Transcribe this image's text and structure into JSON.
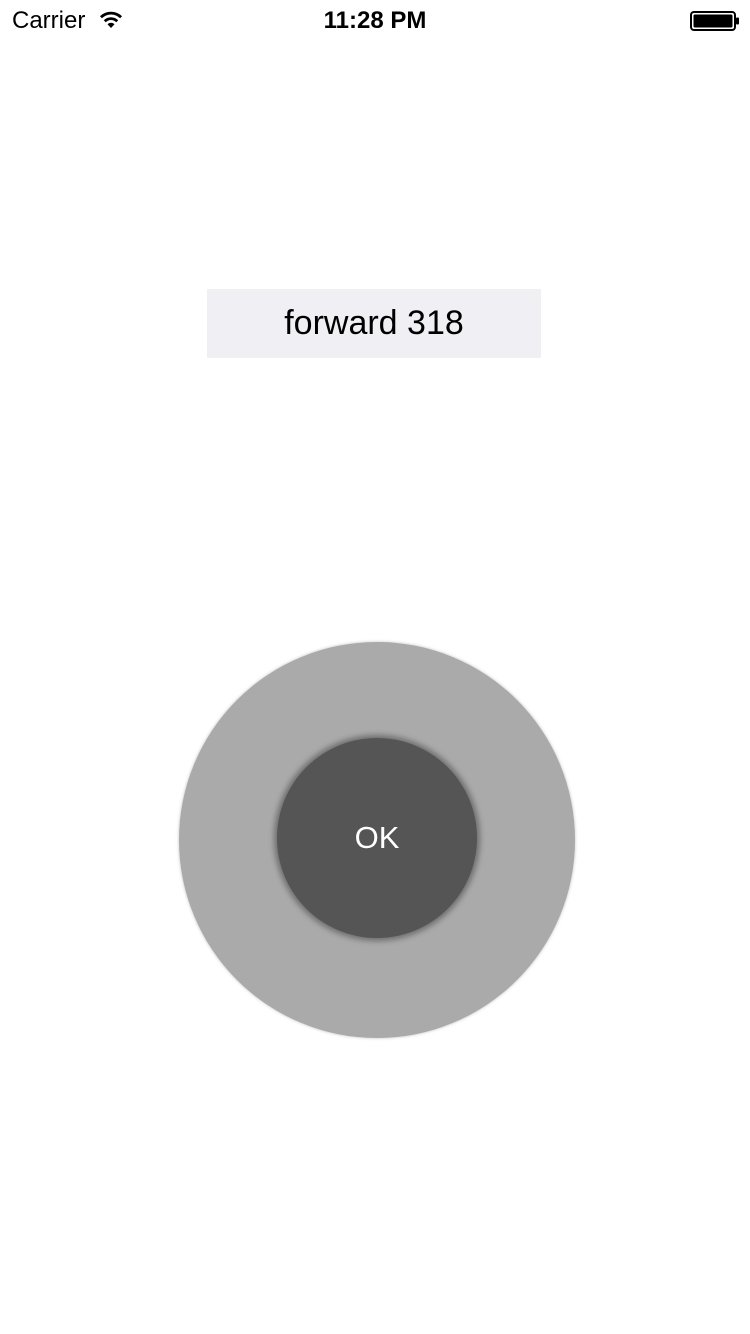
{
  "status_bar": {
    "carrier": "Carrier",
    "time": "11:28 PM",
    "wifi_icon": "wifi-icon",
    "battery_icon": "battery-icon"
  },
  "command": {
    "text": "forward 318"
  },
  "joystick": {
    "ok_label": "OK",
    "outer_color": "#aaaaaa",
    "inner_color": "#555555"
  },
  "colors": {
    "label_background": "#efeff4",
    "page_background": "#ffffff"
  }
}
